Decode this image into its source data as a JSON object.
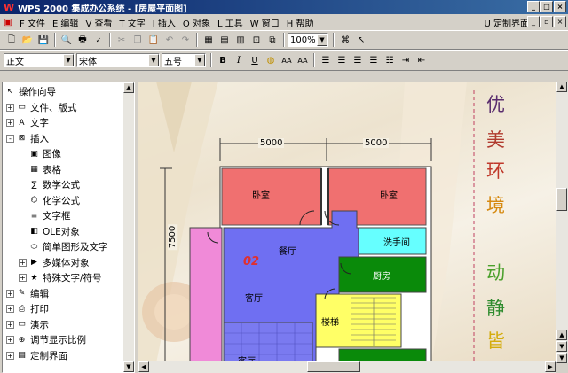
{
  "window": {
    "title": "WPS 2000 集成办公系统 - [房屋平面图]"
  },
  "menu": {
    "items": [
      "F 文件",
      "E 编辑",
      "V 查看",
      "T 文字",
      "I 插入",
      "O 对象",
      "L 工具",
      "W 窗口",
      "H 帮助"
    ],
    "customize": "U 定制界面"
  },
  "format": {
    "style": "正文",
    "font": "宋体",
    "size": "五号",
    "zoom": "100%"
  },
  "tree": {
    "items": [
      {
        "label": "操作向导",
        "level": 0,
        "expander": "",
        "icon": "pointer-icon"
      },
      {
        "label": "文件、版式",
        "level": 1,
        "expander": "+",
        "icon": "folder-icon"
      },
      {
        "label": "文字",
        "level": 1,
        "expander": "+",
        "icon": "text-icon"
      },
      {
        "label": "插入",
        "level": 1,
        "expander": "-",
        "icon": "insert-icon"
      },
      {
        "label": "图像",
        "level": 2,
        "expander": "",
        "icon": "image-icon"
      },
      {
        "label": "表格",
        "level": 2,
        "expander": "",
        "icon": "table-icon"
      },
      {
        "label": "数学公式",
        "level": 2,
        "expander": "",
        "icon": "formula-icon"
      },
      {
        "label": "化学公式",
        "level": 2,
        "expander": "",
        "icon": "chem-icon"
      },
      {
        "label": "文字框",
        "level": 2,
        "expander": "",
        "icon": "textbox-icon"
      },
      {
        "label": "OLE对象",
        "level": 2,
        "expander": "",
        "icon": "ole-icon"
      },
      {
        "label": "简单图形及文字",
        "level": 2,
        "expander": "",
        "icon": "shape-icon"
      },
      {
        "label": "多媒体对象",
        "level": 2,
        "expander": "+",
        "icon": "media-icon"
      },
      {
        "label": "特殊文字/符号",
        "level": 2,
        "expander": "+",
        "icon": "star-icon"
      },
      {
        "label": "编辑",
        "level": 1,
        "expander": "+",
        "icon": "edit-icon"
      },
      {
        "label": "打印",
        "level": 1,
        "expander": "+",
        "icon": "print-icon"
      },
      {
        "label": "演示",
        "level": 1,
        "expander": "+",
        "icon": "present-icon"
      },
      {
        "label": "调节显示比例",
        "level": 1,
        "expander": "+",
        "icon": "zoom-icon"
      },
      {
        "label": "定制界面",
        "level": 1,
        "expander": "+",
        "icon": "custom-icon"
      }
    ]
  },
  "floorplan": {
    "dim_top_left": "5000",
    "dim_top_right": "5000",
    "dim_left": "7500",
    "rooms": {
      "bedroom1": "卧室",
      "bedroom2": "卧室",
      "dining": "餐厅",
      "wash": "洗手间",
      "kitchen": "厨房",
      "living": "客厅",
      "stairs": "楼梯",
      "living2": "客厅",
      "number": "02"
    }
  },
  "side_text": [
    {
      "char": "优",
      "color": "#5a2d6e"
    },
    {
      "char": "美",
      "color": "#b03a2e"
    },
    {
      "char": "环",
      "color": "#c0392b"
    },
    {
      "char": "境",
      "color": "#d68910"
    },
    {
      "char": "动",
      "color": "#4aa02c"
    },
    {
      "char": "静",
      "color": "#2e8b2e"
    },
    {
      "char": "皆",
      "color": "#d4ac0d"
    }
  ]
}
